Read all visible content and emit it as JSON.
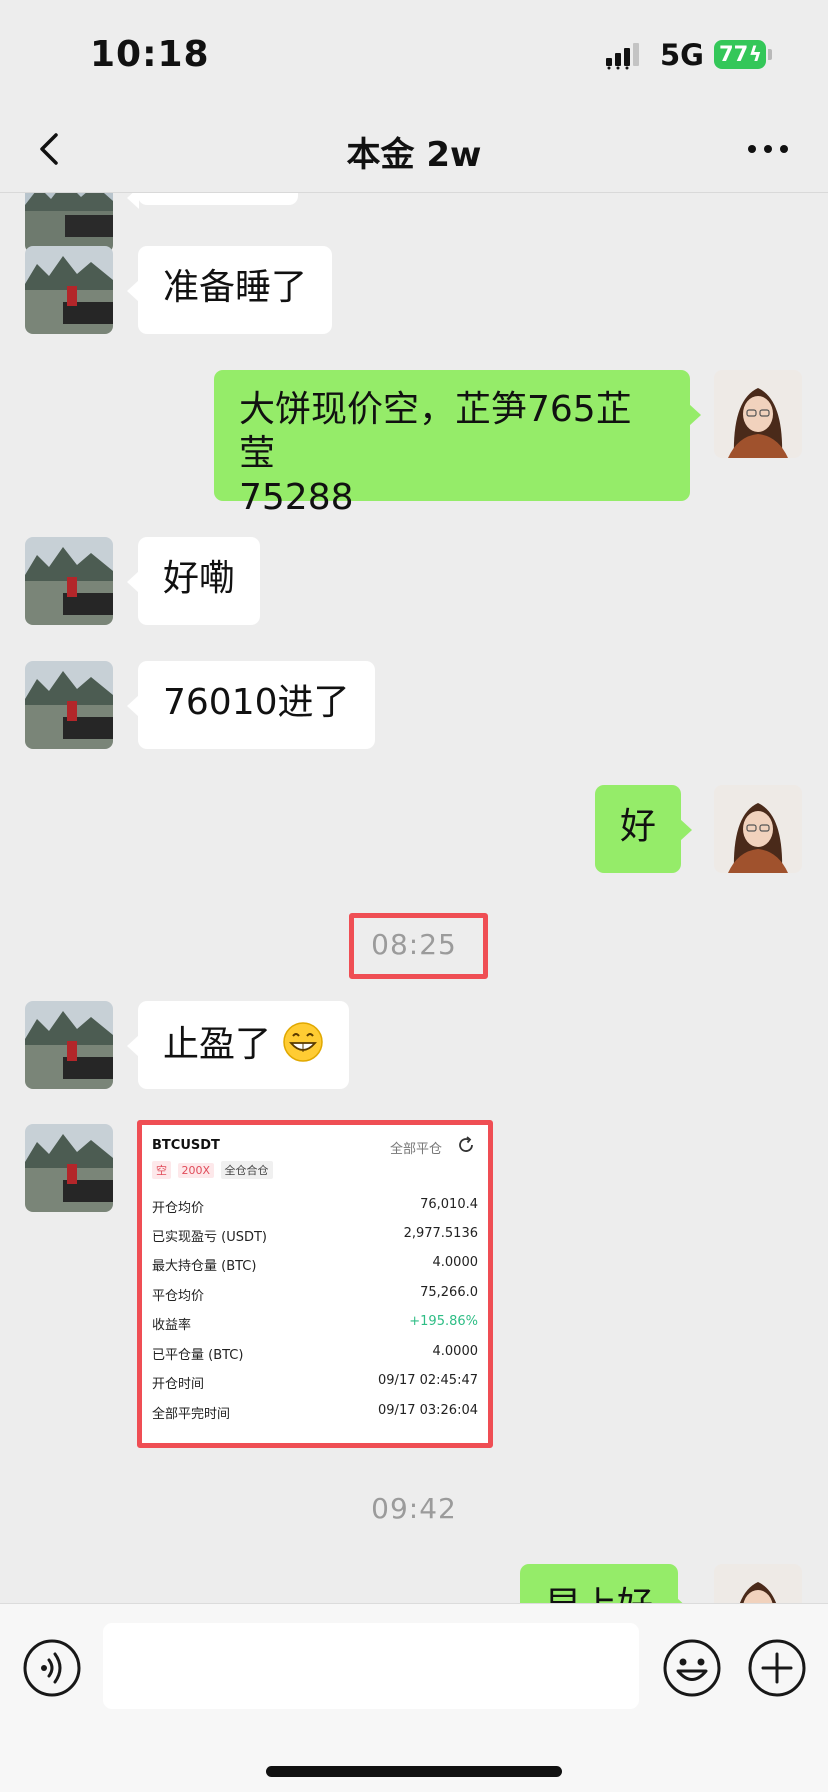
{
  "status_bar": {
    "time": "10:18",
    "network": "5G",
    "battery": "77"
  },
  "header": {
    "title": "本金 2w"
  },
  "messages": [
    {
      "side": "in",
      "text": "准备睡了"
    },
    {
      "side": "out",
      "text_line1": "大饼现价空，芷笋765芷莹",
      "text_line2": "75288"
    },
    {
      "side": "in",
      "text": "好嘞"
    },
    {
      "side": "in",
      "text": "76010进了"
    },
    {
      "side": "out",
      "text": "好"
    },
    {
      "side": "in",
      "text": "止盈了",
      "emoji": "grinning-face-emoji"
    },
    {
      "side": "out",
      "text": "早上好"
    }
  ],
  "timestamps": [
    "08:25",
    "09:42"
  ],
  "trade_card": {
    "symbol": "BTCUSDT",
    "close_all": "全部平仓",
    "tags": [
      "空",
      "200X",
      "全仓合仓"
    ],
    "rows": [
      {
        "label": "开仓均价",
        "value": "76,010.4"
      },
      {
        "label": "已实现盈亏 (USDT)",
        "value": "2,977.5136"
      },
      {
        "label": "最大持仓量 (BTC)",
        "value": "4.0000"
      },
      {
        "label": "平仓均价",
        "value": "75,266.0"
      },
      {
        "label": "收益率",
        "value": "+195.86%"
      },
      {
        "label": "已平仓量 (BTC)",
        "value": "4.0000"
      },
      {
        "label": "开仓时间",
        "value": "09/17 02:45:47"
      },
      {
        "label": "全部平完时间",
        "value": "09/17 03:26:04"
      }
    ]
  },
  "colors": {
    "chat_bg": "#ededed",
    "outgoing_bubble": "#95ec69",
    "incoming_bubble": "#ffffff",
    "highlight_box": "#ef4e54",
    "profit_green": "#2ebd85"
  },
  "icons": [
    "back-icon",
    "more-icon",
    "voice-icon",
    "emoji-icon",
    "plus-icon",
    "refresh-icon",
    "signal-icon"
  ]
}
